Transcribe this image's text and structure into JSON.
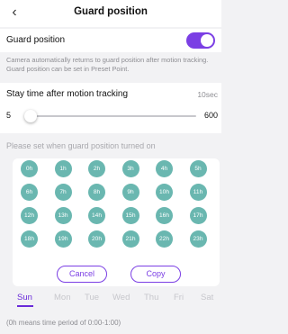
{
  "header": {
    "title": "Guard position",
    "back_icon": "chevron-left-icon"
  },
  "guard_toggle": {
    "label": "Guard position",
    "on": true,
    "accent": "#7b3fe4"
  },
  "description": "Camera automatically returns to guard position after motion tracking. Guard position can be set in Preset Point.",
  "stay_time": {
    "label": "Stay time after motion tracking",
    "value_text": "10sec",
    "min_label": "5",
    "max_label": "600",
    "value": 10,
    "min": 5,
    "max": 600
  },
  "schedule": {
    "label": "Please set when guard position turned on",
    "hours": [
      "0h",
      "1h",
      "2h",
      "3h",
      "4h",
      "5h",
      "6h",
      "7h",
      "8h",
      "9h",
      "10h",
      "11h",
      "12h",
      "13h",
      "14h",
      "15h",
      "16h",
      "17h",
      "18h",
      "19h",
      "20h",
      "21h",
      "22h",
      "23h"
    ],
    "hour_color": "#6ab7b0",
    "cancel_label": "Cancel",
    "copy_label": "Copy",
    "days": [
      "Sun",
      "Mon",
      "Tue",
      "Wed",
      "Thu",
      "Fri",
      "Sat"
    ],
    "selected_day": "Sun",
    "note": "(0h means time period of 0:00-1:00)"
  }
}
